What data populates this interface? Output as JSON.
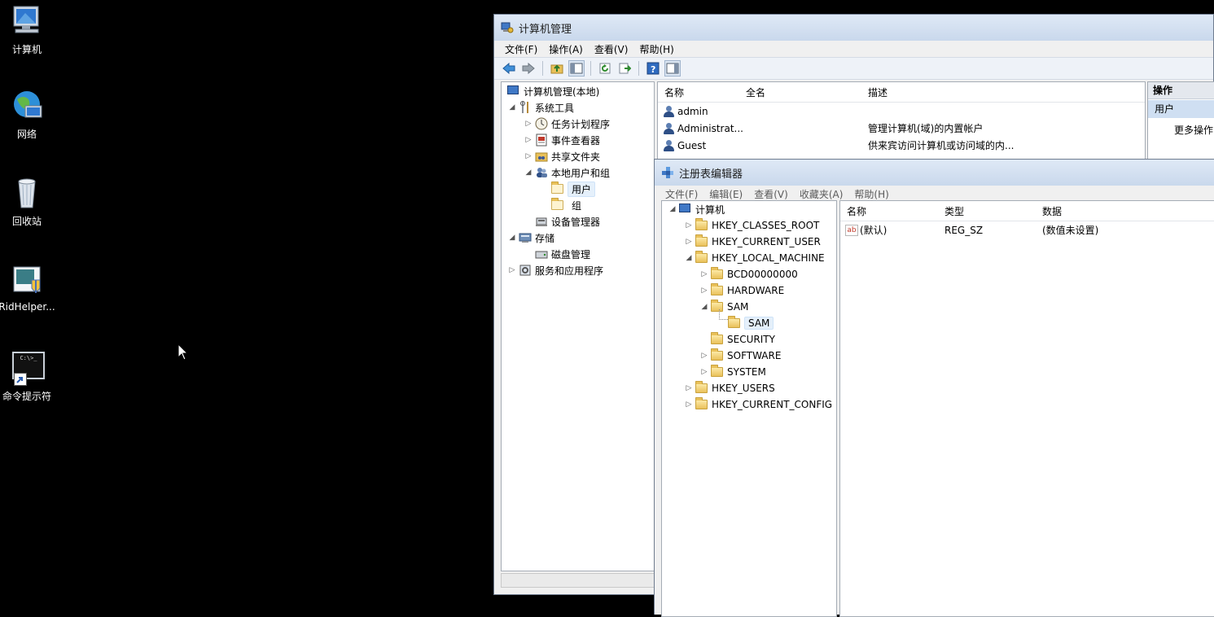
{
  "desktop": {
    "icons": [
      {
        "label": "计算机",
        "icon": "computer-icon"
      },
      {
        "label": "网络",
        "icon": "network-globe-icon"
      },
      {
        "label": "回收站",
        "icon": "recycle-bin-icon"
      },
      {
        "label": "RidHelper...",
        "icon": "ridhelper-shield-icon"
      },
      {
        "label": "命令提示符",
        "icon": "cmd-console-icon"
      }
    ],
    "console_icon_text": "C:\\>_"
  },
  "mmc": {
    "title": "计算机管理",
    "menu": [
      "文件(F)",
      "操作(A)",
      "查看(V)",
      "帮助(H)"
    ],
    "tree": {
      "root": "计算机管理(本地)",
      "system_tools": "系统工具",
      "task_scheduler": "任务计划程序",
      "event_viewer": "事件查看器",
      "shared_folders": "共享文件夹",
      "local_users_groups": "本地用户和组",
      "users": "用户",
      "groups": "组",
      "device_manager": "设备管理器",
      "storage": "存储",
      "disk_management": "磁盘管理",
      "services_apps": "服务和应用程序"
    },
    "list": {
      "headers": {
        "name": "名称",
        "fullname": "全名",
        "desc": "描述"
      },
      "rows": [
        {
          "name": "admin",
          "fullname": "",
          "desc": ""
        },
        {
          "name": "Administrat...",
          "fullname": "",
          "desc": "管理计算机(域)的内置帐户"
        },
        {
          "name": "Guest",
          "fullname": "",
          "desc": "供来宾访问计算机或访问域的内..."
        }
      ]
    },
    "actions": {
      "title": "操作",
      "section": "用户",
      "more": "更多操作"
    }
  },
  "regedit": {
    "title": "注册表编辑器",
    "menu": [
      "文件(F)",
      "编辑(E)",
      "查看(V)",
      "收藏夹(A)",
      "帮助(H)"
    ],
    "tree": {
      "computer": "计算机",
      "hkcr": "HKEY_CLASSES_ROOT",
      "hkcu": "HKEY_CURRENT_USER",
      "hklm": "HKEY_LOCAL_MACHINE",
      "bcd": "BCD00000000",
      "hardware": "HARDWARE",
      "sam": "SAM",
      "sam_child": "SAM",
      "security": "SECURITY",
      "software": "SOFTWARE",
      "system": "SYSTEM",
      "hku": "HKEY_USERS",
      "hkcc": "HKEY_CURRENT_CONFIG"
    },
    "values": {
      "headers": {
        "name": "名称",
        "type": "类型",
        "data": "数据"
      },
      "rows": [
        {
          "name": "(默认)",
          "type": "REG_SZ",
          "data": "(数值未设置)",
          "icon_text": "ab"
        }
      ]
    }
  }
}
